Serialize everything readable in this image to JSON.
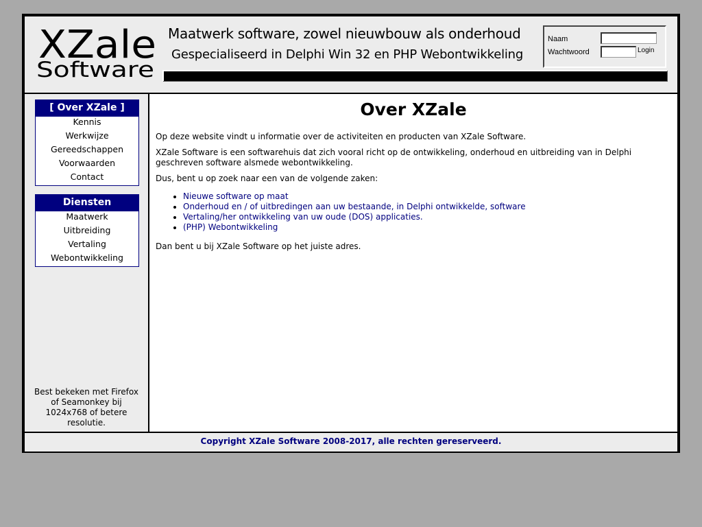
{
  "header": {
    "logo": {
      "line1": "XZale",
      "line2": "Software"
    },
    "tagline1": "Maatwerk software, zowel nieuwbouw als onderhoud",
    "tagline2": "Gespecialiseerd in Delphi Win 32 en PHP Webontwikkeling"
  },
  "login": {
    "name_label": "Naam",
    "name_value": "",
    "password_label": "Wachtwoord",
    "password_value": "",
    "button_label": "Login"
  },
  "sidebar": {
    "menu_over": {
      "title": "[ Over XZale ]",
      "items": [
        {
          "label": "Kennis"
        },
        {
          "label": "Werkwijze"
        },
        {
          "label": "Gereedschappen"
        },
        {
          "label": "Voorwaarden"
        },
        {
          "label": "Contact"
        }
      ]
    },
    "menu_diensten": {
      "title": "Diensten",
      "items": [
        {
          "label": "Maatwerk"
        },
        {
          "label": "Uitbreiding"
        },
        {
          "label": "Vertaling"
        },
        {
          "label": "Webontwikkeling"
        }
      ]
    },
    "browser_note": "Best bekeken met Firefox of Seamonkey bij 1024x768 of betere resolutie."
  },
  "content": {
    "title": "Over XZale",
    "intro": "Op deze website vindt u informatie over de activiteiten en producten van XZale Software.",
    "description": "XZale Software is een softwarehuis dat zich vooral richt op de ontwikkeling, onderhoud en uitbreiding van in Delphi geschreven software alsmede webontwikkeling.",
    "question": "Dus, bent u op zoek naar een van de volgende zaken:",
    "services": [
      {
        "label": "Nieuwe software op maat"
      },
      {
        "label": "Onderhoud en / of uitbredingen aan uw bestaande, in Delphi ontwikkelde, software"
      },
      {
        "label": "Vertaling/her ontwikkeling van uw oude (DOS) applicaties."
      },
      {
        "label": "(PHP) Webontwikkeling"
      }
    ],
    "closing": "Dan bent u bij XZale Software op het juiste adres."
  },
  "footer": {
    "copyright": "Copyright XZale Software 2008-2017, alle rechten gereserveerd."
  },
  "colors": {
    "page_background": "#a9a9a9",
    "panel_background": "#ececec",
    "accent_navy": "#00007f",
    "border": "#000000"
  }
}
